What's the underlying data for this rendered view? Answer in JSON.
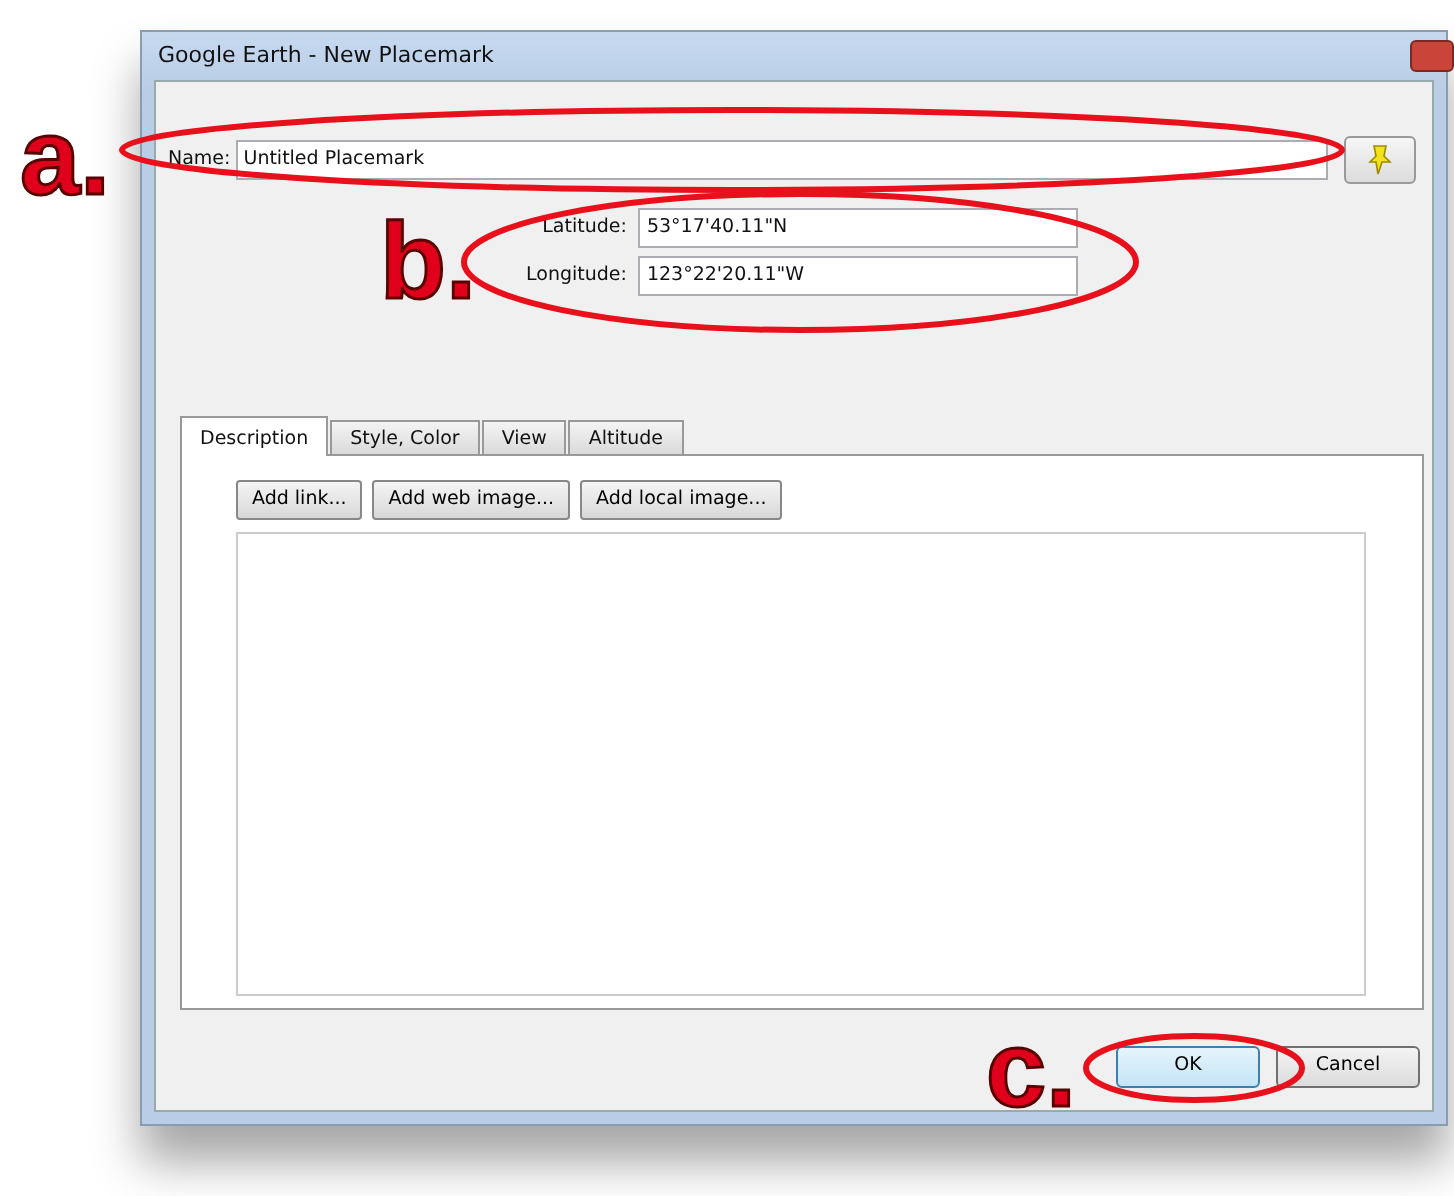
{
  "window": {
    "title": "Google Earth - New Placemark"
  },
  "name": {
    "label": "Name:",
    "value": "Untitled Placemark"
  },
  "coordinates": [
    {
      "label": "Latitude:",
      "value": "53°17'40.11\"N"
    },
    {
      "label": "Longitude:",
      "value": "123°22'20.11\"W"
    }
  ],
  "tabs": [
    {
      "label": "Description",
      "selected": true
    },
    {
      "label": "Style, Color",
      "selected": false
    },
    {
      "label": "View",
      "selected": false
    },
    {
      "label": "Altitude",
      "selected": false
    }
  ],
  "description_buttons": [
    "Add link...",
    "Add web image...",
    "Add local image..."
  ],
  "buttons": [
    {
      "label": "OK",
      "default": true
    },
    {
      "label": "Cancel",
      "default": false
    }
  ],
  "annotations": [
    {
      "label": "a."
    },
    {
      "label": "b."
    },
    {
      "label": "c."
    }
  ]
}
